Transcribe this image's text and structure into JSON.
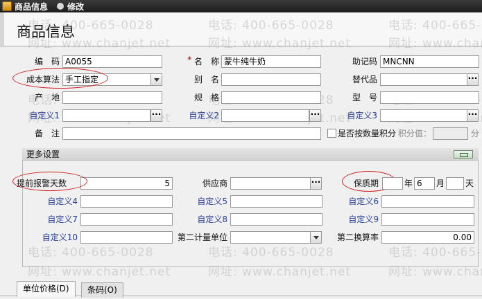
{
  "titlebar": {
    "title": "商品信息",
    "action": "修改"
  },
  "page_title": "商品信息",
  "watermark": {
    "phone": "电话: 400-665-0028",
    "site": "网址: www.chanjet.net"
  },
  "fields": {
    "code": {
      "label": "编　码",
      "value": "A0055"
    },
    "name": {
      "label": "名　称",
      "required_mark": "*",
      "value": "蒙牛纯牛奶"
    },
    "mnemonic": {
      "label": "助记码",
      "value": "MNCNN"
    },
    "costing": {
      "label": "成本算法",
      "value": "手工指定"
    },
    "alias": {
      "label": "别　名",
      "value": ""
    },
    "substitute": {
      "label": "替代品",
      "value": ""
    },
    "origin": {
      "label": "产　地",
      "value": ""
    },
    "spec": {
      "label": "规　格",
      "value": ""
    },
    "model": {
      "label": "型　号",
      "value": ""
    },
    "custom1": {
      "label": "自定义1",
      "value": ""
    },
    "custom2": {
      "label": "自定义2",
      "value": ""
    },
    "custom3": {
      "label": "自定义3",
      "value": ""
    },
    "remark": {
      "label": "备　注",
      "value": ""
    },
    "points_by_qty": {
      "label": "是否按数量积分",
      "checked": false
    },
    "points_value": {
      "label": "积分值：",
      "value": "",
      "unit": "分"
    }
  },
  "more_settings": {
    "title": "更多设置",
    "alert_days": {
      "label": "提前报警天数",
      "value": "5"
    },
    "supplier": {
      "label": "供应商",
      "value": ""
    },
    "shelf_life": {
      "label": "保质期",
      "years": "",
      "year_unit": "年",
      "months": "6",
      "month_unit": "月",
      "days": "",
      "day_unit": "天"
    },
    "custom4": {
      "label": "自定义4",
      "value": ""
    },
    "custom5": {
      "label": "自定义5",
      "value": ""
    },
    "custom6": {
      "label": "自定义6",
      "value": ""
    },
    "custom7": {
      "label": "自定义7",
      "value": ""
    },
    "custom8": {
      "label": "自定义8",
      "value": ""
    },
    "custom9": {
      "label": "自定义9",
      "value": ""
    },
    "custom10": {
      "label": "自定义10",
      "value": ""
    },
    "second_unit": {
      "label": "第二计量单位",
      "value": ""
    },
    "second_rate": {
      "label": "第二换算率",
      "value": "0.00"
    }
  },
  "tabs": [
    {
      "label": "单位价格(D)"
    },
    {
      "label": "条码(O)"
    }
  ],
  "colors": {
    "annotation_oval": "#d02020",
    "custom_label": "#2a3f92",
    "required": "#c00000"
  }
}
